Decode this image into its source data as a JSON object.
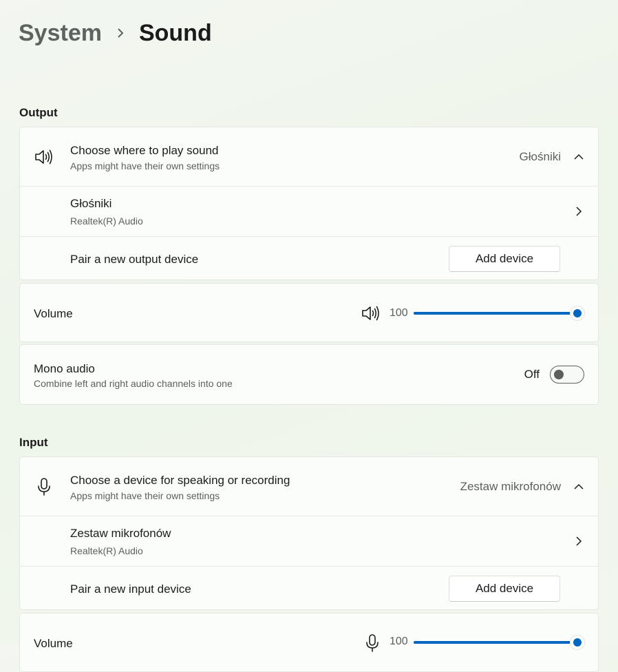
{
  "breadcrumb": {
    "parent": "System",
    "current": "Sound"
  },
  "output": {
    "title": "Output",
    "choose": {
      "title": "Choose where to play sound",
      "subtitle": "Apps might have their own settings",
      "value": "Głośniki"
    },
    "device": {
      "name": "Głośniki",
      "driver": "Realtek(R) Audio"
    },
    "pair": {
      "label": "Pair a new output device",
      "button": "Add device"
    },
    "volume": {
      "label": "Volume",
      "value": "100",
      "level": 1.0
    },
    "mono": {
      "title": "Mono audio",
      "subtitle": "Combine left and right audio channels into one",
      "state": "Off"
    }
  },
  "input": {
    "title": "Input",
    "choose": {
      "title": "Choose a device for speaking or recording",
      "subtitle": "Apps might have their own settings",
      "value": "Zestaw mikrofonów"
    },
    "device": {
      "name": "Zestaw mikrofonów",
      "driver": "Realtek(R) Audio"
    },
    "pair": {
      "label": "Pair a new input device",
      "button": "Add device"
    },
    "volume": {
      "label": "Volume",
      "value": "100",
      "level": 1.0
    }
  },
  "colors": {
    "accent": "#0067c0",
    "background": "#eef5ea",
    "card": "#fbfdfa"
  }
}
